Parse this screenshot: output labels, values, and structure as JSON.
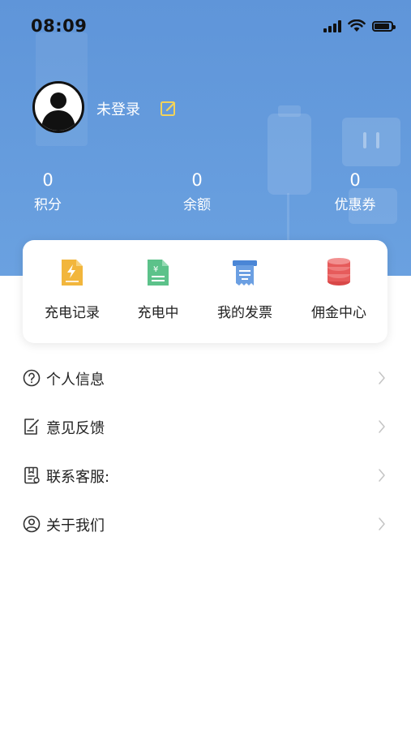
{
  "status_bar": {
    "time": "08:09"
  },
  "profile": {
    "login_status": "未登录"
  },
  "stats": [
    {
      "value": "0",
      "label": "积分"
    },
    {
      "value": "0",
      "label": "余额"
    },
    {
      "value": "0",
      "label": "优惠券"
    }
  ],
  "quick_actions": [
    {
      "label": "充电记录",
      "icon": "charge-record-icon",
      "color": "#f2b63c"
    },
    {
      "label": "充电中",
      "icon": "charging-icon",
      "color": "#5cc28a"
    },
    {
      "label": "我的发票",
      "icon": "invoice-icon",
      "color": "#4a86d6"
    },
    {
      "label": "佣金中心",
      "icon": "commission-icon",
      "color": "#e65b5b"
    }
  ],
  "menu": [
    {
      "label": "个人信息",
      "icon": "question-circle-icon"
    },
    {
      "label": "意见反馈",
      "icon": "feedback-icon"
    },
    {
      "label": "联系客服:",
      "icon": "customer-service-icon"
    },
    {
      "label": "关于我们",
      "icon": "user-circle-icon"
    }
  ],
  "colors": {
    "header_blue": "#6aa1e0",
    "accent_yellow": "#f2b63c"
  }
}
